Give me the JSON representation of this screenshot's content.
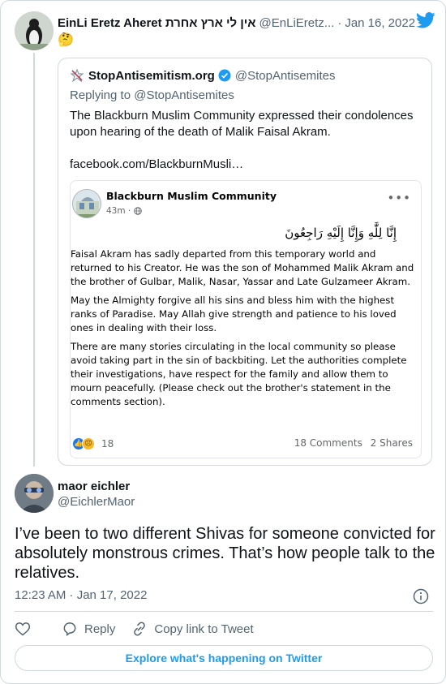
{
  "parent_tweet": {
    "name": "EinLi Eretz Aheret אין לי ארץ אחרת",
    "handle": "@EnLiEretz...",
    "date": "Jan 16, 2022",
    "emoji": "🤔"
  },
  "quoted_tweet": {
    "name": "StopAntisemitism.org",
    "handle": "@StopAntisemites",
    "replying_to": "Replying to @StopAntisemites",
    "text_lines": [
      "The Blackburn Muslim Community expressed their condolences",
      "upon hearing of the death of Malik Faisal Akram."
    ],
    "link": "facebook.com/BlackburnMusli…"
  },
  "facebook_post": {
    "page_name": "Blackburn Muslim Community",
    "time": "43m",
    "arabic": "إِنَّا لِلَّٰهِ وَإِنَّا إِلَيْهِ رَاجِعُونَ",
    "paragraphs": [
      "Faisal Akram has sadly departed from this temporary world and returned to his Creator. He was the son of Mohammed Malik Akram and the brother of Gulbar, Malik, Nasar, Yassar and Late Gulzameer Akram.",
      "May the Almighty forgive all his sins and bless him with the highest ranks of Paradise. May Allah give strength and patience to his loved ones in dealing with their loss.",
      "There are many stories circulating in the local community so please avoid taking part in the sin of backbiting. Let the authorities complete their investigations, have respect for the family and allow them to mourn peacefully. (Please check out the brother's statement in the comments section)."
    ],
    "reaction_count": "18",
    "comments": "18 Comments",
    "shares": "2 Shares"
  },
  "main_tweet": {
    "name": "maor eichler",
    "handle": "@EichlerMaor",
    "text": "I’ve been to two different Shivas for someone convicted for absolutely monstrous crimes. That’s how people talk to the relatives.",
    "timestamp": "12:23 AM · Jan 17, 2022"
  },
  "actions": {
    "reply": "Reply",
    "copy_link": "Copy link to Tweet"
  },
  "explore_button": "Explore what's happening on Twitter",
  "colors": {
    "twitter_blue": "#1d9bf0",
    "text_primary": "#0f1419",
    "text_secondary": "#536471",
    "border": "#cfd9de"
  }
}
